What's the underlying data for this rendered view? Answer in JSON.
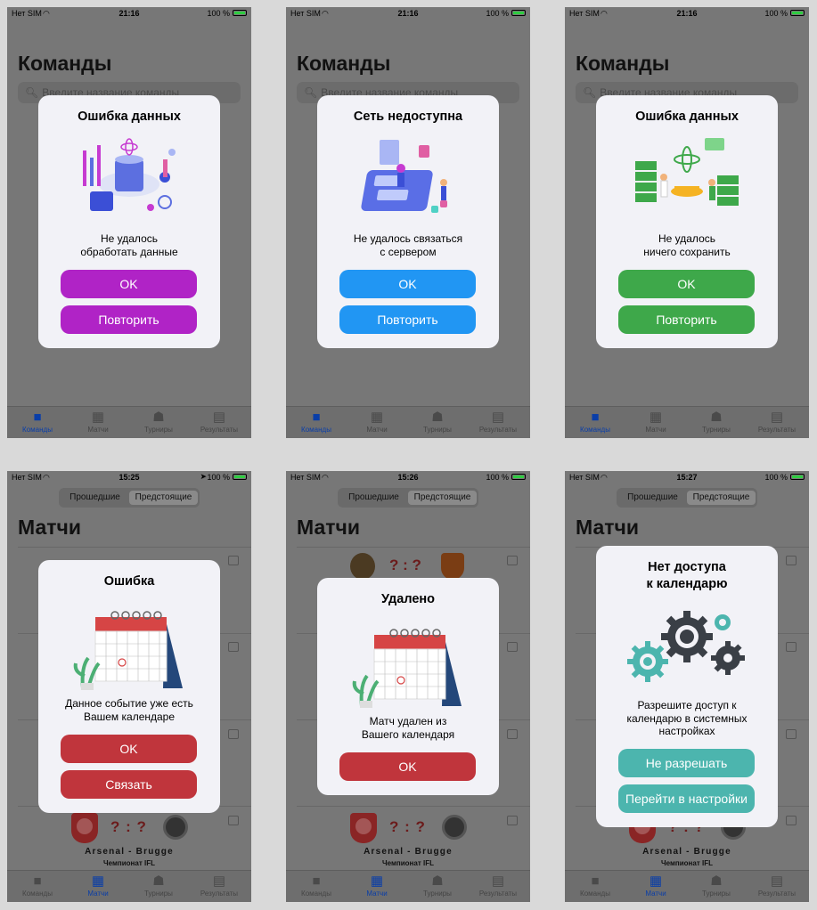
{
  "screens": [
    {
      "status": {
        "carrier": "Нет SIM",
        "time": "21:16",
        "battery": "100 %"
      },
      "title": "Команды",
      "search_placeholder": "Введите название команды",
      "alert": {
        "title": "Ошибка данных",
        "message_line1": "Не удалось",
        "message_line2": "обработать данные",
        "buttons": [
          "OK",
          "Повторить"
        ],
        "accent": "#b023c6"
      },
      "active_tab": "Команды"
    },
    {
      "status": {
        "carrier": "Нет SIM",
        "time": "21:16",
        "battery": "100 %"
      },
      "title": "Команды",
      "search_placeholder": "Введите название команды",
      "alert": {
        "title": "Сеть недоступна",
        "message_line1": "Не удалось связаться",
        "message_line2": "с сервером",
        "buttons": [
          "OK",
          "Повторить"
        ],
        "accent": "#2196f3"
      },
      "active_tab": "Команды"
    },
    {
      "status": {
        "carrier": "Нет SIM",
        "time": "21:16",
        "battery": "100 %"
      },
      "title": "Команды",
      "search_placeholder": "Введите название команды",
      "alert": {
        "title": "Ошибка данных",
        "message_line1": "Не удалось",
        "message_line2": "ничего сохранить",
        "buttons": [
          "OK",
          "Повторить"
        ],
        "accent": "#3ea84a"
      },
      "active_tab": "Команды"
    },
    {
      "status": {
        "carrier": "Нет SIM",
        "time": "15:25",
        "battery": "100 %"
      },
      "segment": [
        "Прошедшие",
        "Предстоящие"
      ],
      "title": "Матчи",
      "alert": {
        "title": "Ошибка",
        "message_line1": "Данное событие уже есть",
        "message_line2": "Вашем календаре",
        "buttons": [
          "OK",
          "Связать"
        ],
        "accent": "#c0353c"
      },
      "match": {
        "home": "Arsenal",
        "away": "Brugge",
        "teams": "Arsenal - Brugge",
        "score": "? : ?",
        "league": "Чемпионат IFL"
      },
      "active_tab": "Матчи"
    },
    {
      "status": {
        "carrier": "Нет SIM",
        "time": "15:26",
        "battery": "100 %"
      },
      "segment": [
        "Прошедшие",
        "Предстоящие"
      ],
      "title": "Матчи",
      "alert": {
        "title": "Удалено",
        "message_line1": "Матч удален из",
        "message_line2": "Вашего календаря",
        "buttons": [
          "OK"
        ],
        "accent": "#c0353c"
      },
      "top_match": {
        "score": "? : ?"
      },
      "match": {
        "home": "Arsenal",
        "away": "Brugge",
        "teams": "Arsenal - Brugge",
        "score": "? : ?",
        "league": "Чемпионат IFL"
      },
      "active_tab": "Матчи"
    },
    {
      "status": {
        "carrier": "Нет SIM",
        "time": "15:27",
        "battery": "100 %"
      },
      "segment": [
        "Прошедшие",
        "Предстоящие"
      ],
      "title": "Матчи",
      "alert": {
        "title_line1": "Нет доступа",
        "title_line2": "к календарю",
        "message_line1": "Разрешите доступ к",
        "message_line2": "календарю в системных",
        "message_line3": "настройках",
        "buttons": [
          "Не разрешать",
          "Перейти в настройки"
        ],
        "accent": "#4cb5ae"
      },
      "match": {
        "home": "Arsenal",
        "away": "Brugge",
        "teams": "Arsenal - Brugge",
        "score": "? : ?",
        "league": "Чемпионат IFL"
      },
      "active_tab": "Матчи"
    }
  ],
  "tabs": [
    "Команды",
    "Матчи",
    "Турниры",
    "Результаты"
  ],
  "tab_icons": [
    "jersey-icon",
    "calendar-icon",
    "trophy-icon",
    "clipboard-icon"
  ]
}
